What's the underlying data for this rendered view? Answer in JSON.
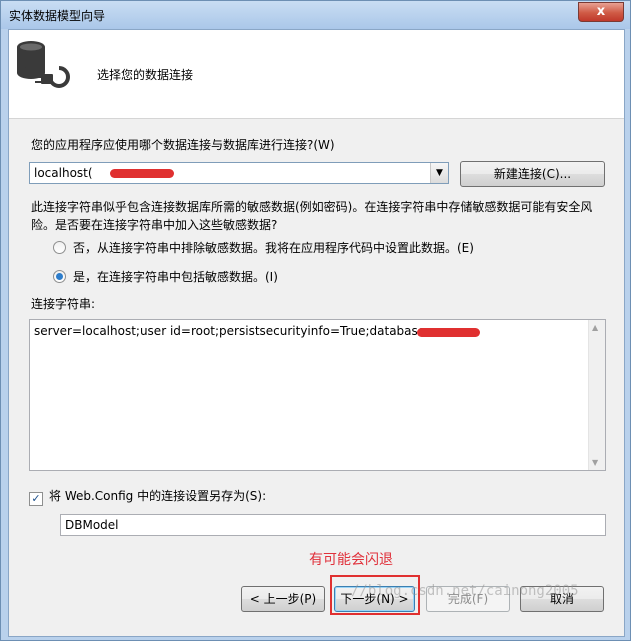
{
  "window": {
    "title": "实体数据模型向导",
    "close_label": "x"
  },
  "header": {
    "title": "选择您的数据连接",
    "icon": "database-plug-icon"
  },
  "connection": {
    "question": "您的应用程序应使用哪个数据连接与数据库进行连接?(W)",
    "selected_value": "localhost(",
    "new_connection_button": "新建连接(C)..."
  },
  "sensitive": {
    "warning": "此连接字符串似乎包含连接数据库所需的敏感数据(例如密码)。在连接字符串中存储敏感数据可能有安全风险。是否要在连接字符串中加入这些敏感数据?",
    "option_exclude": "否，从连接字符串中排除敏感数据。我将在应用程序代码中设置此数据。(E)",
    "option_include": "是，在连接字符串中包括敏感数据。(I)",
    "selected": "include"
  },
  "connection_string": {
    "label": "连接字符串:",
    "value": "server=localhost;user id=root;persistsecurityinfo=True;database="
  },
  "save_config": {
    "checkbox_label": "将 Web.Config 中的连接设置另存为(S):",
    "checked": true,
    "model_name": "DBModel"
  },
  "annotation": "有可能会闪退",
  "buttons": {
    "prev": "< 上一步(P)",
    "next": "下一步(N) >",
    "finish": "完成(F)",
    "cancel": "取消"
  },
  "watermark": "//blog.csdn.net/cainong2005",
  "colors": {
    "annotation_red": "#e0313b",
    "radio_selected": "#2d7dcb"
  }
}
